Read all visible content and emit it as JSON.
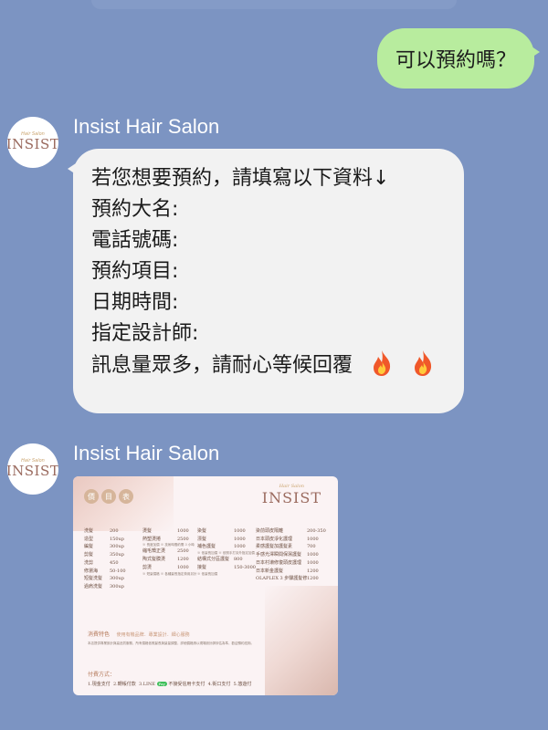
{
  "outgoing": {
    "text": "可以預約嗎？"
  },
  "sender": {
    "name": "Insist Hair Salon",
    "logo_small": "Hair Salon",
    "logo_main": "INSIST"
  },
  "message": {
    "lines": [
      "若您想要預約，請填寫以下資料↓",
      "預約大名:",
      "電話號碼:",
      "預約項目:",
      "日期時間:",
      "指定設計師:",
      "訊息量眾多，請耐心等候回覆"
    ]
  },
  "menu_card": {
    "badges": [
      "價",
      "目",
      "表"
    ],
    "logo_small": "Hair Salon",
    "logo_main": "INSIST",
    "col1": [
      {
        "n": "洗髮",
        "p": "200"
      },
      {
        "n": "造型",
        "p": "150up"
      },
      {
        "n": "編髮",
        "p": "300up"
      },
      {
        "n": "剪髮",
        "p": "350up"
      },
      {
        "n": "洗剪",
        "p": "450"
      },
      {
        "n": "修瀏海",
        "p": "50-100"
      },
      {
        "n": "短髮洗髮",
        "p": "300up"
      },
      {
        "n": "過肩洗髮",
        "p": "300up"
      }
    ],
    "col2": [
      {
        "n": "燙髮",
        "p": "1000"
      },
      {
        "n": "熱塑燙捲",
        "p": "2500"
      },
      {
        "n": "",
        "p": ""
      },
      {
        "n": "縮毛矯正燙",
        "p": "2500"
      },
      {
        "n": "陶式髮膜燙",
        "p": "1200"
      },
      {
        "n": "剪燙",
        "p": "1000"
      },
      {
        "n": "",
        "p": ""
      },
      {
        "n": "",
        "p": ""
      }
    ],
    "col3": [
      {
        "n": "染髮",
        "p": "1000"
      },
      {
        "n": "漂髮",
        "p": "1000"
      },
      {
        "n": "補色護髮",
        "p": "1000"
      },
      {
        "n": "",
        "p": ""
      },
      {
        "n": "結構式分區護髮",
        "p": "800"
      },
      {
        "n": "",
        "p": ""
      },
      {
        "n": "接髮",
        "p": "150-3000"
      },
      {
        "n": "",
        "p": ""
      }
    ],
    "col4": [
      {
        "n": "染前頭皮隔離",
        "p": "200-350"
      },
      {
        "n": "日本頭皮淨化護理",
        "p": "1000"
      },
      {
        "n": "柔感護髮加護髮素",
        "p": "700"
      },
      {
        "n": "手感光澤瞬間保濕護髮",
        "p": "1000"
      },
      {
        "n": "",
        "p": ""
      },
      {
        "n": "日本村瀨修復頭皮護理",
        "p": "1000"
      },
      {
        "n": "日本新金護髮",
        "p": "1200"
      },
      {
        "n": "OLAPLEX 3 步驟護髮修復",
        "p": "1200"
      }
    ],
    "notes": {
      "col2_a": "※ 長度加價\n※ 技術時間約需 3 小時",
      "col2_b": "※ 短髮價格\n※ 各種髮長指定費用另計",
      "col3_a": "※ 依髮長加價\n※ 依照手打另外指定加價",
      "col3_b": "※ 依髮長加價"
    },
    "extra_title": "消費特色",
    "extra_sub": "使用有機品牌．專業設計．細心服務",
    "extra_text": "本店提供專業設計與高品質服務，所有價格依照髮長與髮量調整，詳細價格請以現場設計師評估為準，歡迎預約諮詢。",
    "pay_title": "付費方式：",
    "pay_items": [
      "1.現金支付",
      "2.轉帳付款",
      "3.LINE",
      "Pay",
      "不接受信用卡支付",
      "4.街口支付",
      "5.悠遊付"
    ]
  }
}
